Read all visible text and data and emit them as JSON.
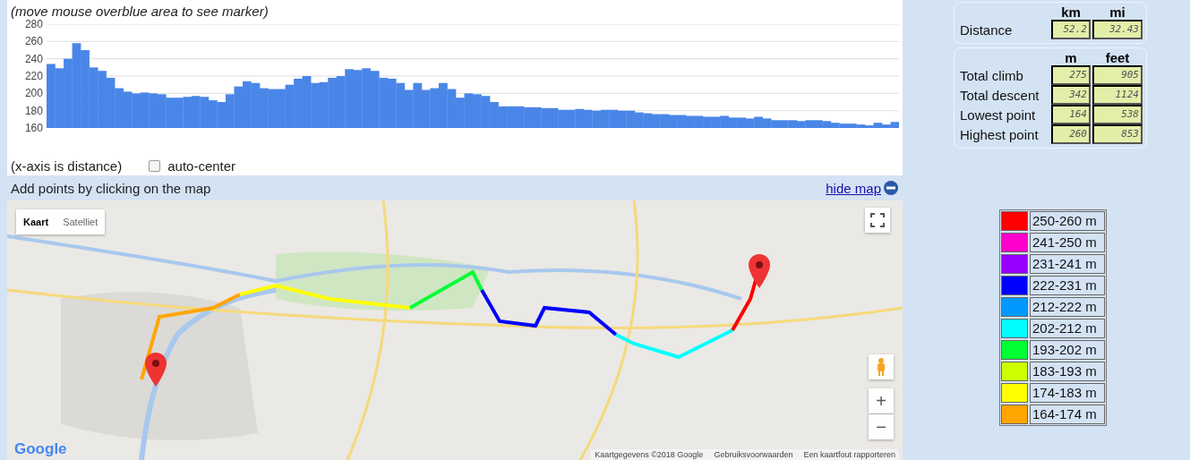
{
  "chart": {
    "hint": "(move mouse overblue area to see marker)",
    "chart_data": {
      "type": "bar",
      "grid": true,
      "ylim": [
        160,
        280
      ],
      "yticks": [
        160,
        180,
        200,
        220,
        240,
        260,
        280
      ],
      "values": [
        234,
        229,
        240,
        258,
        250,
        230,
        226,
        218,
        206,
        202,
        200,
        201,
        200,
        199,
        195,
        195,
        196,
        197,
        196,
        192,
        190,
        199,
        208,
        214,
        212,
        206,
        205,
        205,
        210,
        217,
        220,
        212,
        213,
        218,
        220,
        228,
        227,
        229,
        226,
        218,
        217,
        212,
        204,
        212,
        204,
        206,
        212,
        205,
        195,
        200,
        199,
        197,
        190,
        185,
        185,
        185,
        184,
        184,
        183,
        183,
        181,
        181,
        182,
        181,
        180,
        181,
        181,
        180,
        180,
        178,
        177,
        176,
        176,
        175,
        175,
        174,
        174,
        173,
        173,
        174,
        172,
        172,
        171,
        173,
        171,
        169,
        169,
        169,
        168,
        169,
        169,
        168,
        166,
        165,
        165,
        164,
        163,
        166,
        164,
        167
      ]
    },
    "axis_note": "(x-axis is distance)",
    "auto_center": {
      "label": "auto-center",
      "checked": false
    }
  },
  "map_bar": {
    "instruction": "Add points by clicking on the map",
    "hide_link": "hide map"
  },
  "map": {
    "kind": "picture",
    "map_types": [
      {
        "label": "Kaart",
        "selected": true
      },
      {
        "label": "Satelliet",
        "selected": false
      }
    ],
    "zoom_in": "+",
    "zoom_out": "−",
    "logo": "Google",
    "attribution": [
      "Kaartgegevens ©2018 Google",
      "Gebruiksvoorwaarden",
      "Een kaartfout rapporteren"
    ]
  },
  "distance": {
    "columns": [
      "km",
      "mi"
    ],
    "rows": [
      {
        "label": "Distance",
        "values": [
          "52.2",
          "32.43"
        ]
      }
    ]
  },
  "elevation": {
    "columns": [
      "m",
      "feet"
    ],
    "rows": [
      {
        "label": "Total climb",
        "values": [
          "275",
          "905"
        ]
      },
      {
        "label": "Total descent",
        "values": [
          "342",
          "1124"
        ]
      },
      {
        "label": "Lowest point",
        "values": [
          "164",
          "538"
        ]
      },
      {
        "label": "Highest point",
        "values": [
          "260",
          "853"
        ]
      }
    ]
  },
  "legend": [
    {
      "label": "250-260 m",
      "color": "#ff0000"
    },
    {
      "label": "241-250 m",
      "color": "#ff00cc"
    },
    {
      "label": "231-241 m",
      "color": "#9900ff"
    },
    {
      "label": "222-231 m",
      "color": "#0000ff"
    },
    {
      "label": "212-222 m",
      "color": "#0099ff"
    },
    {
      "label": "202-212 m",
      "color": "#00ffff"
    },
    {
      "label": "193-202 m",
      "color": "#00ff33"
    },
    {
      "label": "183-193 m",
      "color": "#ccff00"
    },
    {
      "label": "174-183 m",
      "color": "#ffff00"
    },
    {
      "label": "164-174 m",
      "color": "#ffa500"
    }
  ]
}
